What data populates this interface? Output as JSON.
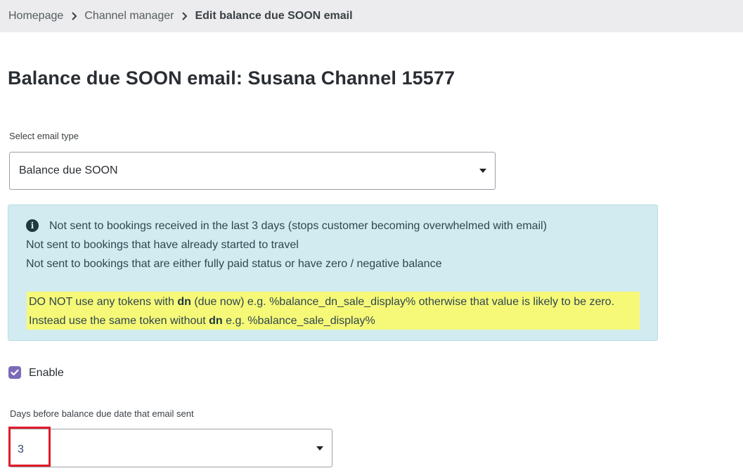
{
  "breadcrumb": {
    "items": [
      {
        "label": "Homepage"
      },
      {
        "label": "Channel manager"
      },
      {
        "label": "Edit balance due SOON email"
      }
    ]
  },
  "page": {
    "title": "Balance due SOON email: Susana Channel 15577"
  },
  "email_type": {
    "label": "Select email type",
    "value": "Balance due SOON"
  },
  "info": {
    "lines": [
      "Not sent to bookings received in the last 3 days (stops customer becoming overwhelmed with email)",
      "Not sent to bookings that have already started to travel",
      "Not sent to bookings that are either fully paid status or have zero / negative balance"
    ],
    "warning_line1": {
      "before": "DO NOT use any tokens with ",
      "bold": "dn",
      "after": " (due now) e.g. %balance_dn_sale_display% otherwise that value is likely to be zero."
    },
    "warning_line2": {
      "before": "Instead use the same token without ",
      "bold": "dn",
      "after": " e.g. %balance_sale_display%"
    }
  },
  "enable": {
    "label": "Enable",
    "checked": true
  },
  "days_before": {
    "label": "Days before balance due date that email sent",
    "value": "3"
  },
  "colors": {
    "accent_checkbox": "#7d6ab8",
    "info_bg": "#d2ebf0",
    "highlight": "#f6f977",
    "annotation_red": "#e01b2a"
  }
}
